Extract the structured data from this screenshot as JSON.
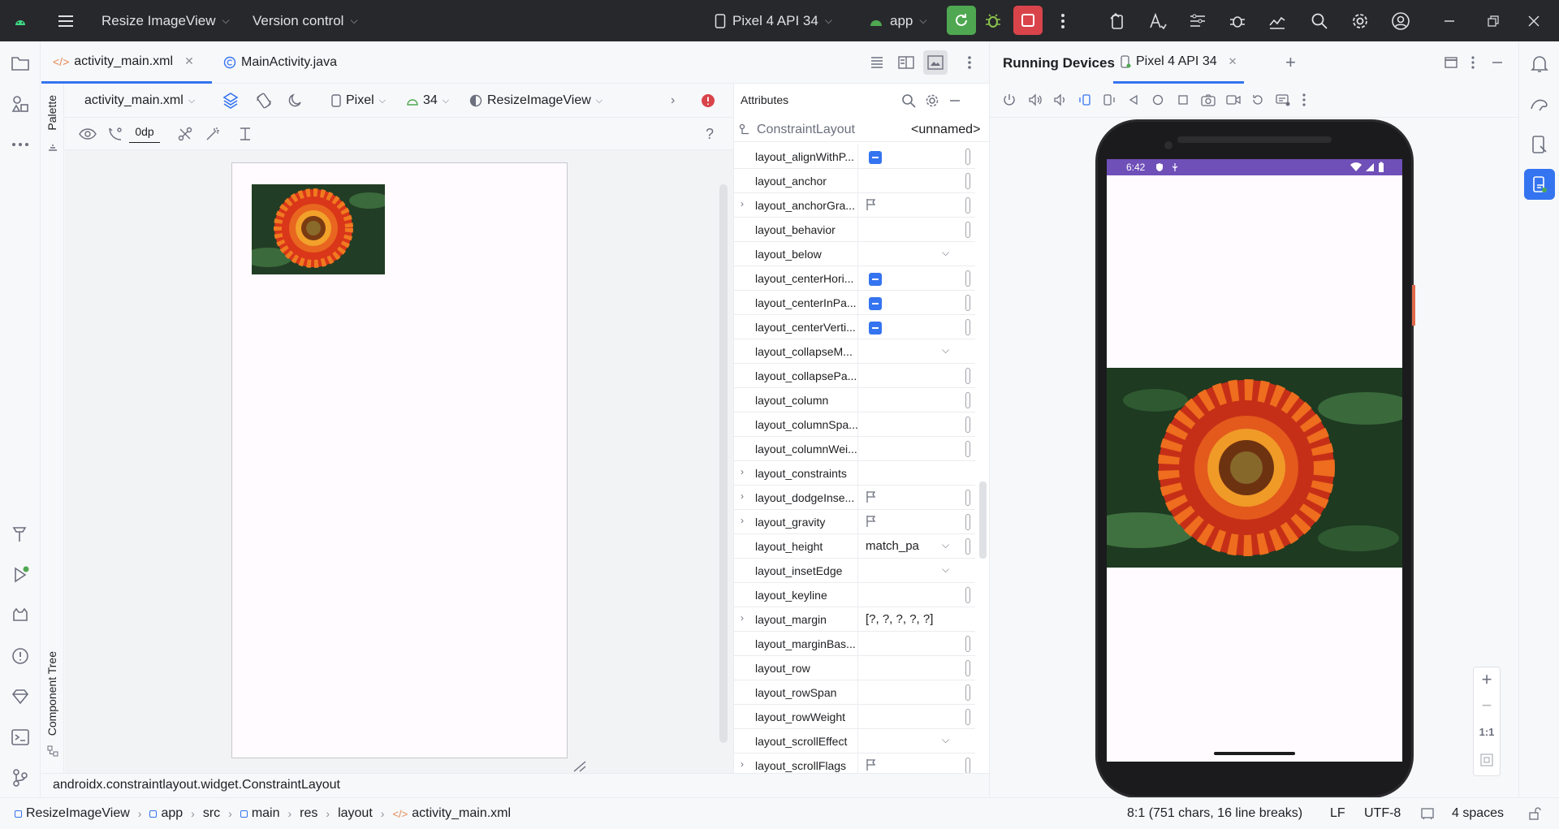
{
  "titlebar": {
    "project": "Resize ImageView",
    "vcs": "Version control",
    "device": "Pixel 4 API 34",
    "run_config": "app"
  },
  "editor_tabs": [
    {
      "label": "activity_main.xml",
      "active": true
    },
    {
      "label": "MainActivity.java",
      "active": false
    }
  ],
  "design_toolbar": {
    "file": "activity_main.xml",
    "device": "Pixel",
    "api": "34",
    "theme": "ResizeImageView",
    "margin": "0dp",
    "help": "?"
  },
  "side_labels": {
    "palette": "Palette",
    "component_tree": "Component Tree"
  },
  "attributes": {
    "title": "Attributes",
    "component": "ConstraintLayout",
    "id": "<unnamed>",
    "rows": [
      {
        "name": "layout_alignWithP...",
        "kind": "check"
      },
      {
        "name": "layout_anchor",
        "kind": "bar"
      },
      {
        "name": "layout_anchorGra...",
        "kind": "flag",
        "expand": true
      },
      {
        "name": "layout_behavior",
        "kind": "bar"
      },
      {
        "name": "layout_below",
        "kind": "dropdown"
      },
      {
        "name": "layout_centerHori...",
        "kind": "check"
      },
      {
        "name": "layout_centerInPa...",
        "kind": "check"
      },
      {
        "name": "layout_centerVerti...",
        "kind": "check"
      },
      {
        "name": "layout_collapseM...",
        "kind": "dropdown"
      },
      {
        "name": "layout_collapsePa...",
        "kind": "bar"
      },
      {
        "name": "layout_column",
        "kind": "bar"
      },
      {
        "name": "layout_columnSpa...",
        "kind": "bar"
      },
      {
        "name": "layout_columnWei...",
        "kind": "bar"
      },
      {
        "name": "layout_constraints",
        "kind": "none",
        "expand": true
      },
      {
        "name": "layout_dodgeInse...",
        "kind": "flag",
        "expand": true
      },
      {
        "name": "layout_gravity",
        "kind": "flag",
        "expand": true
      },
      {
        "name": "layout_height",
        "kind": "value-dropdown",
        "value": "match_pa"
      },
      {
        "name": "layout_insetEdge",
        "kind": "dropdown"
      },
      {
        "name": "layout_keyline",
        "kind": "bar"
      },
      {
        "name": "layout_margin",
        "kind": "value",
        "value": "[?, ?, ?, ?, ?]",
        "expand": true
      },
      {
        "name": "layout_marginBas...",
        "kind": "bar"
      },
      {
        "name": "layout_row",
        "kind": "bar"
      },
      {
        "name": "layout_rowSpan",
        "kind": "bar"
      },
      {
        "name": "layout_rowWeight",
        "kind": "bar"
      },
      {
        "name": "layout_scrollEffect",
        "kind": "dropdown"
      },
      {
        "name": "layout_scrollFlags",
        "kind": "flag",
        "expand": true
      }
    ]
  },
  "running_devices": {
    "title": "Running Devices",
    "tab": "Pixel 4 API 34",
    "time": "6:42",
    "zoom_reset": "1:1"
  },
  "status_path": "androidx.constraintlayout.widget.ConstraintLayout",
  "breadcrumbs": [
    "ResizeImageView",
    "app",
    "src",
    "main",
    "res",
    "layout",
    "activity_main.xml"
  ],
  "status_right": {
    "position": "8:1 (751 chars, 16 line breaks)",
    "line_ending": "LF",
    "encoding": "UTF-8",
    "indent": "4 spaces"
  },
  "colors": {
    "titlebar_bg": "#27282c",
    "accent": "#3574f0",
    "run_green": "#4fa851",
    "stop_red": "#d9444b",
    "phone_status": "#6f4fb8"
  }
}
